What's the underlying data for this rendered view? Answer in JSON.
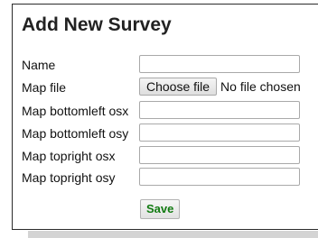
{
  "form": {
    "title": "Add New Survey",
    "fields": [
      {
        "label": "Name",
        "value": ""
      },
      {
        "label": "Map file",
        "button_label": "Choose file",
        "status": "No file chosen"
      },
      {
        "label": "Map bottomleft osx",
        "value": ""
      },
      {
        "label": "Map bottomleft osy",
        "value": ""
      },
      {
        "label": "Map topright osx",
        "value": ""
      },
      {
        "label": "Map topright osy",
        "value": ""
      }
    ],
    "save_label": "Save",
    "colors": {
      "save_text": "#117a11",
      "border": "#2b2b2b"
    }
  }
}
